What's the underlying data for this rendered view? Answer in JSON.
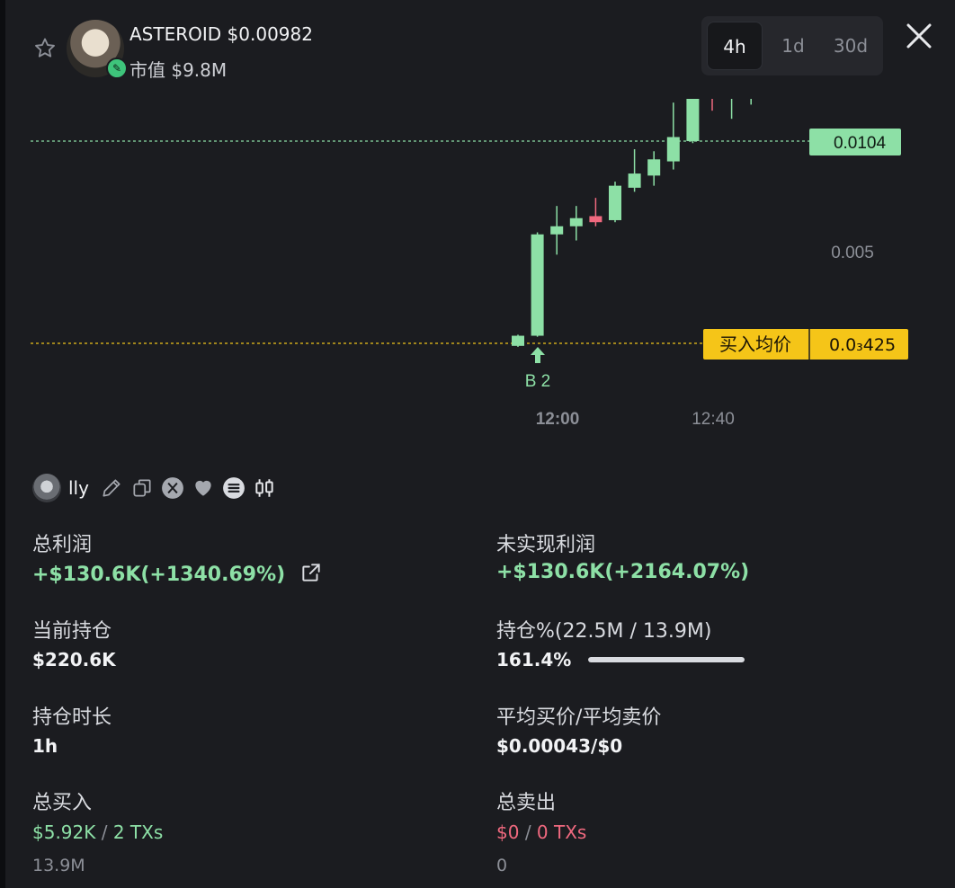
{
  "header": {
    "token_name": "ASTEROID",
    "token_price": "$0.00982",
    "market_cap_label": "市值",
    "market_cap_value": "$9.8M",
    "favorite_icon": "star-outline-icon",
    "close_icon": "close-icon"
  },
  "timeframes": [
    {
      "label": "4h",
      "active": true
    },
    {
      "label": "1d",
      "active": false
    },
    {
      "label": "30d",
      "active": false
    }
  ],
  "chart_data": {
    "type": "candlestick",
    "current_price_label": "0.0104",
    "current_price": 0.0104,
    "y_tick_label": "0.005",
    "y_tick": 0.005,
    "avg_buy_label": "买入均价",
    "avg_buy_value_display": "0.0₃425",
    "avg_buy_value": 0.000425,
    "x_ticks": [
      "12:00",
      "12:40"
    ],
    "buy_marker_label": "B 2",
    "colors": {
      "up": "#8de0a6",
      "down": "#f0697f",
      "avg_line": "#f0c419",
      "price_line": "#8de0a6"
    },
    "candles": [
      {
        "open": 0.0003,
        "close": 0.0008,
        "high": 0.00085,
        "low": 0.00025
      },
      {
        "open": 0.0008,
        "close": 0.0058,
        "high": 0.0059,
        "low": 0.00075
      },
      {
        "open": 0.0058,
        "close": 0.0062,
        "high": 0.0072,
        "low": 0.0048
      },
      {
        "open": 0.0062,
        "close": 0.0066,
        "high": 0.0072,
        "low": 0.0055
      },
      {
        "open": 0.0067,
        "close": 0.0064,
        "high": 0.0076,
        "low": 0.0062
      },
      {
        "open": 0.0065,
        "close": 0.0082,
        "high": 0.0084,
        "low": 0.0064
      },
      {
        "open": 0.0081,
        "close": 0.0088,
        "high": 0.01,
        "low": 0.0079
      },
      {
        "open": 0.0087,
        "close": 0.0095,
        "high": 0.0099,
        "low": 0.0082
      },
      {
        "open": 0.0094,
        "close": 0.0106,
        "high": 0.0123,
        "low": 0.009
      },
      {
        "open": 0.0104,
        "close": 0.0135,
        "high": 0.0145,
        "low": 0.0103
      },
      {
        "open": 0.0133,
        "close": 0.0131,
        "high": 0.0153,
        "low": 0.0119
      },
      {
        "open": 0.0131,
        "close": 0.0133,
        "high": 0.0142,
        "low": 0.0115
      },
      {
        "open": 0.0134,
        "close": 0.0144,
        "high": 0.0148,
        "low": 0.0122
      }
    ]
  },
  "wallet": {
    "name": "lly",
    "icons": [
      "edit-icon",
      "copy-icon",
      "x-icon",
      "heart-icon",
      "solana-icon",
      "candles-icon"
    ]
  },
  "stats": {
    "total_profit_label": "总利润",
    "total_profit_value": "+$130.6K(+1340.69%)",
    "unrealized_label": "未实现利润",
    "unrealized_value": "+$130.6K(+2164.07%)",
    "holding_label": "当前持仓",
    "holding_value": "$220.6K",
    "holding_pct_label": "持仓%(22.5M / 13.9M)",
    "holding_pct_value": "161.4%",
    "holding_pct_fraction": 1.0,
    "duration_label": "持仓时长",
    "duration_value": "1h",
    "avg_price_label": "平均买价/平均卖价",
    "avg_price_value": "$0.00043/$0",
    "total_buy_label": "总买入",
    "total_buy_amount": "$5.92K",
    "total_buy_txs": "2 TXs",
    "total_buy_qty": "13.9M",
    "total_sell_label": "总卖出",
    "total_sell_amount": "$0",
    "total_sell_txs": "0 TXs",
    "total_sell_qty": "0",
    "separator": "/"
  }
}
